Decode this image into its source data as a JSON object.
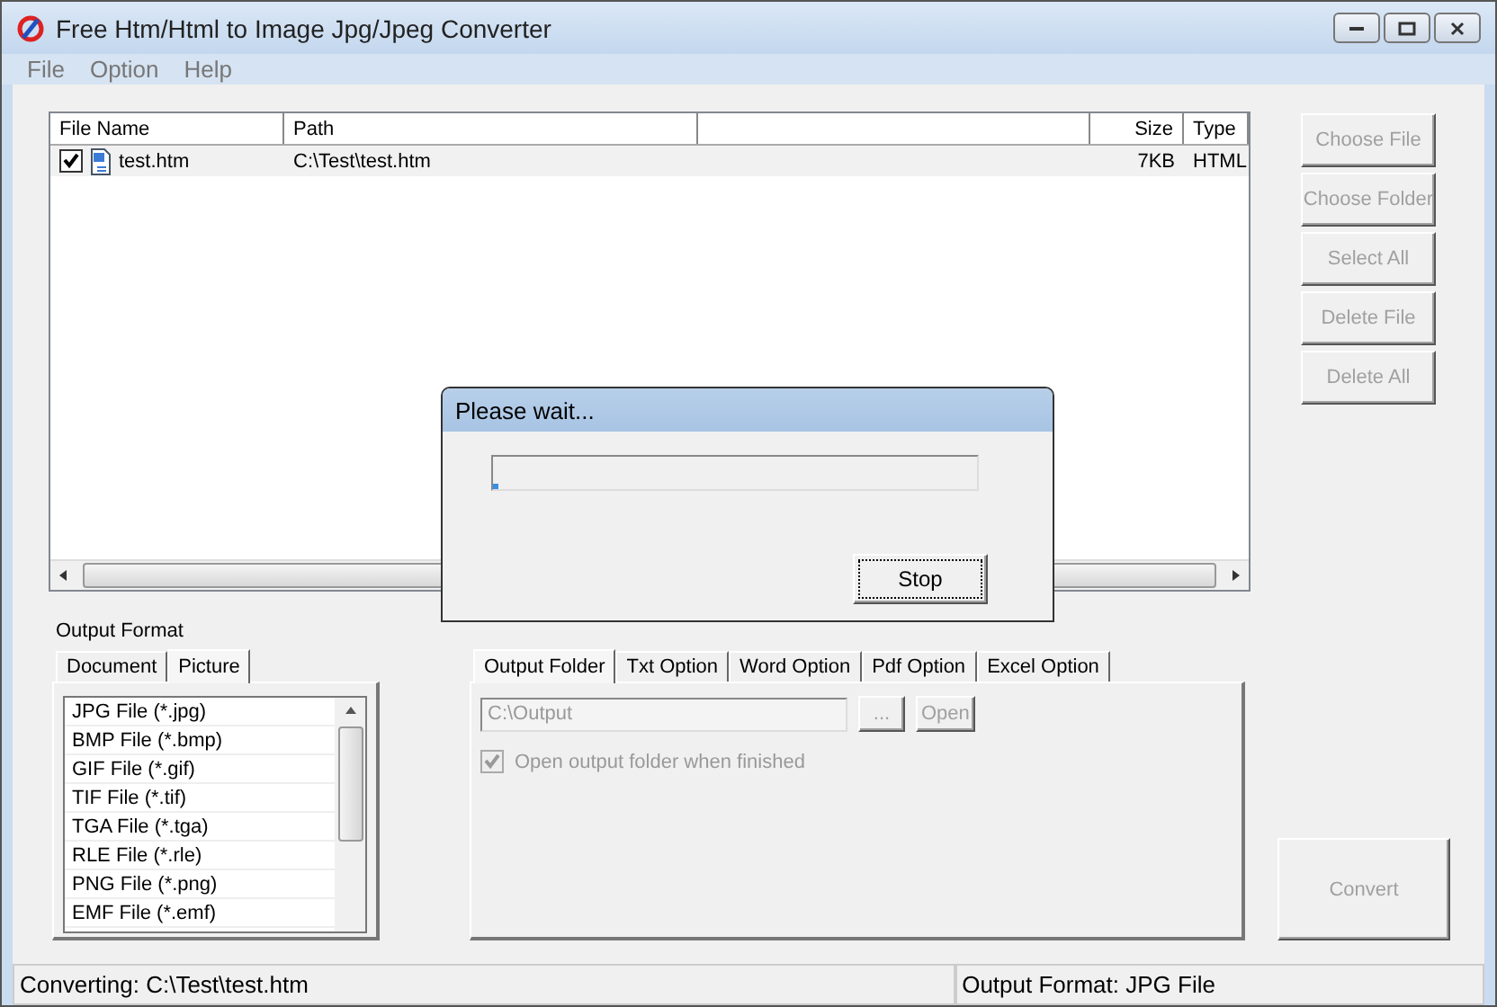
{
  "window": {
    "title": "Free Htm/Html to Image Jpg/Jpeg Converter"
  },
  "menu": [
    "File",
    "Option",
    "Help"
  ],
  "file_list": {
    "columns": [
      "File Name",
      "Path",
      "Size",
      "Type"
    ],
    "rows": [
      {
        "checked": true,
        "file_name": "test.htm",
        "path": "C:\\Test\\test.htm",
        "size": "7KB",
        "type": "HTML"
      }
    ]
  },
  "side_buttons": [
    {
      "label": "Choose File",
      "disabled": true
    },
    {
      "label": "Choose Folder",
      "disabled": true
    },
    {
      "label": "Select All",
      "disabled": true
    },
    {
      "label": "Delete File",
      "disabled": true
    },
    {
      "label": "Delete All",
      "disabled": true
    }
  ],
  "output_format_label": "Output Format",
  "format_tabs": [
    {
      "label": "Document",
      "selected": false
    },
    {
      "label": "Picture",
      "selected": true
    }
  ],
  "formats": [
    "JPG File  (*.jpg)",
    "BMP File  (*.bmp)",
    "GIF File  (*.gif)",
    "TIF File  (*.tif)",
    "TGA File  (*.tga)",
    "RLE File  (*.rle)",
    "PNG File  (*.png)",
    "EMF File  (*.emf)"
  ],
  "option_tabs": [
    {
      "label": "Output Folder",
      "selected": true
    },
    {
      "label": "Txt Option",
      "selected": false
    },
    {
      "label": "Word Option",
      "selected": false
    },
    {
      "label": "Pdf Option",
      "selected": false
    },
    {
      "label": "Excel Option",
      "selected": false
    }
  ],
  "output_folder": {
    "value": "C:\\Output",
    "browse_label": "...",
    "open_label": "Open",
    "disabled": true
  },
  "open_when_finished": {
    "label": "Open output folder when finished",
    "checked": true,
    "disabled": true
  },
  "convert": {
    "label": "Convert",
    "disabled": true
  },
  "status_bar": [
    "Converting:  C:\\Test\\test.htm",
    "Output Format: JPG File"
  ],
  "dialog": {
    "title": "Please wait...",
    "level": 0.01,
    "button": "Stop"
  }
}
